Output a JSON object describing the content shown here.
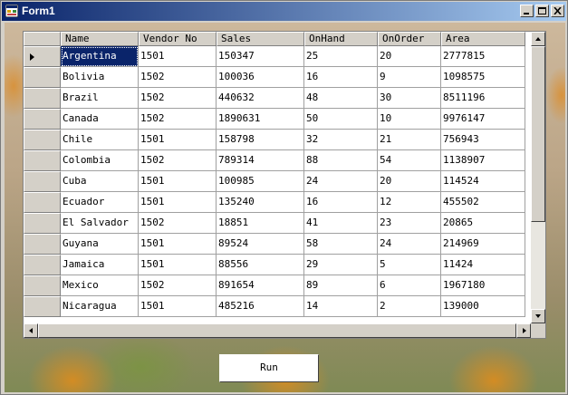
{
  "window": {
    "title": "Form1"
  },
  "grid": {
    "columns": [
      "Name",
      "Vendor No",
      "Sales",
      "OnHand",
      "OnOrder",
      "Area"
    ],
    "rows": [
      [
        "Argentina",
        "1501",
        "150347",
        "25",
        "20",
        "2777815"
      ],
      [
        "Bolivia",
        "1502",
        "100036",
        "16",
        "9",
        "1098575"
      ],
      [
        "Brazil",
        "1502",
        "440632",
        "48",
        "30",
        "8511196"
      ],
      [
        "Canada",
        "1502",
        "1890631",
        "50",
        "10",
        "9976147"
      ],
      [
        "Chile",
        "1501",
        "158798",
        "32",
        "21",
        "756943"
      ],
      [
        "Colombia",
        "1502",
        "789314",
        "88",
        "54",
        "1138907"
      ],
      [
        "Cuba",
        "1501",
        "100985",
        "24",
        "20",
        "114524"
      ],
      [
        "Ecuador",
        "1501",
        "135240",
        "16",
        "12",
        "455502"
      ],
      [
        "El Salvador",
        "1502",
        "18851",
        "41",
        "23",
        "20865"
      ],
      [
        "Guyana",
        "1501",
        "89524",
        "58",
        "24",
        "214969"
      ],
      [
        "Jamaica",
        "1501",
        "88556",
        "29",
        "5",
        "11424"
      ],
      [
        "Mexico",
        "1502",
        "891654",
        "89",
        "6",
        "1967180"
      ],
      [
        "Nicaragua",
        "1501",
        "485216",
        "14",
        "2",
        "139000"
      ]
    ],
    "current_row_index": 0
  },
  "buttons": {
    "run": "Run"
  },
  "colors": {
    "titlebar_start": "#0a246a",
    "titlebar_end": "#a6caf0",
    "selection": "#0a246a",
    "face": "#d4d0c8"
  },
  "icons": {
    "app": "form-icon",
    "minimize": "minimize-icon",
    "maximize": "maximize-icon",
    "close": "close-icon"
  }
}
